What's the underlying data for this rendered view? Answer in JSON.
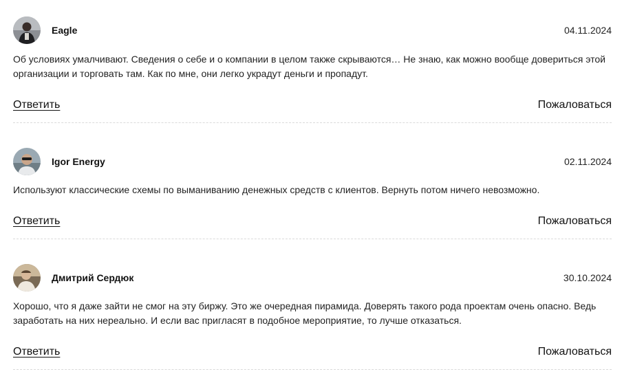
{
  "comments": [
    {
      "author": "Eagle",
      "date": "04.11.2024",
      "avatar_icon": "user-photo-avatar",
      "text": "Об условиях умалчивают. Сведения о себе и о компании в целом также скрываются… Не знаю, как можно вообще довериться этой организации и торговать там. Как по мне, они легко украдут деньги и пропадут.",
      "reply_label": "Ответить",
      "report_label": "Пожаловаться"
    },
    {
      "author": "Igor Energy",
      "date": "02.11.2024",
      "avatar_icon": "user-photo-avatar",
      "text": "Используют классические схемы по выманиванию денежных средств с клиентов. Вернуть потом ничего невозможно.",
      "reply_label": "Ответить",
      "report_label": "Пожаловаться"
    },
    {
      "author": "Дмитрий Сердюк",
      "date": "30.10.2024",
      "avatar_icon": "user-photo-avatar",
      "text": "Хорошо, что я даже зайти не смог на эту биржу. Это же очередная пирамида. Доверять такого рода проектам очень опасно. Ведь заработать на них нереально. И если вас пригласят в подобное мероприятие, то лучше отказаться.",
      "reply_label": "Ответить",
      "report_label": "Пожаловаться"
    }
  ]
}
